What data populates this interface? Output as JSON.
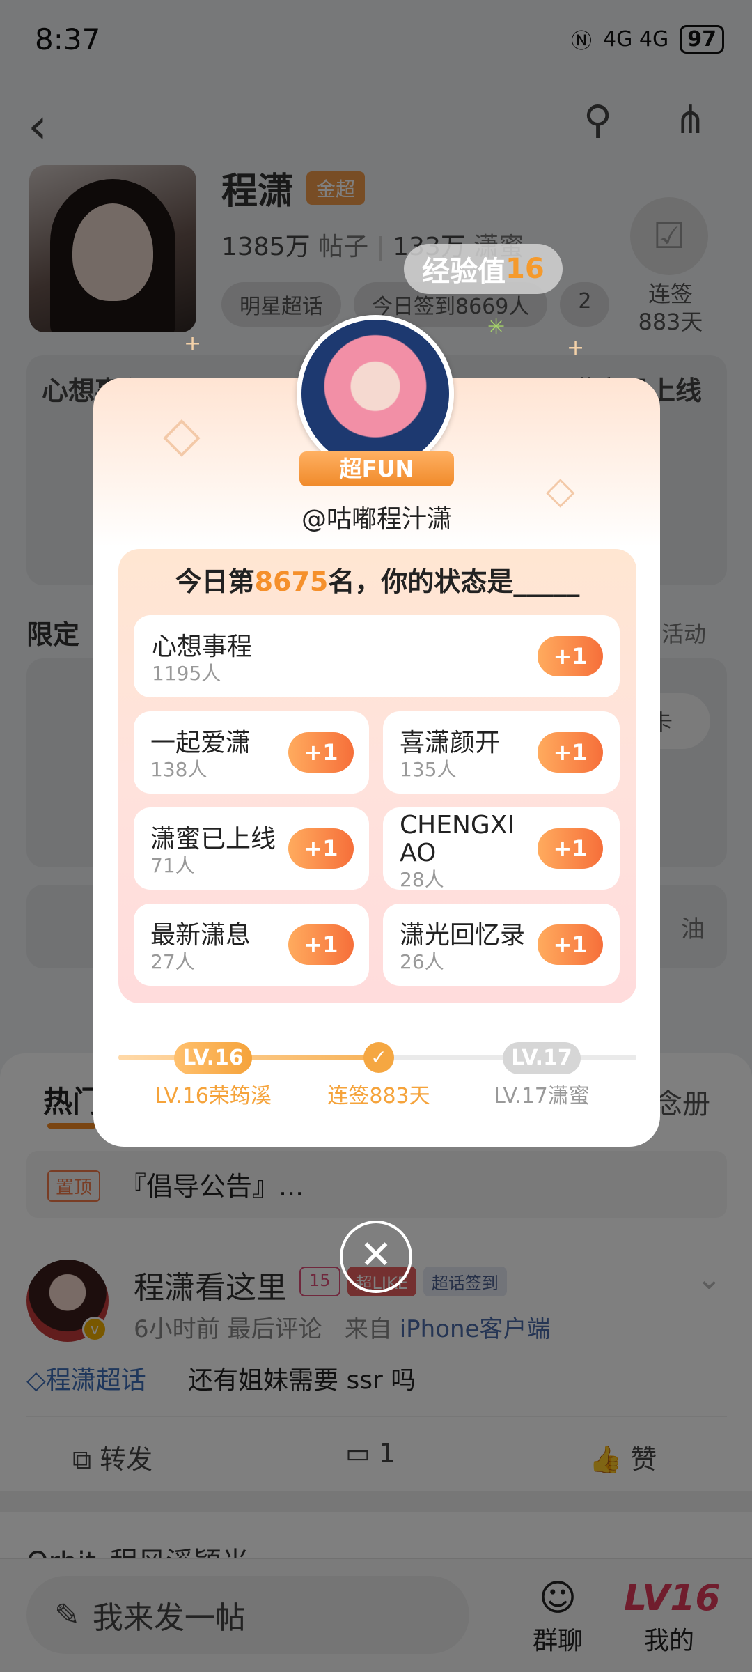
{
  "status_bar": {
    "time": "8:37",
    "signal": "4G 4G",
    "battery": "97"
  },
  "profile": {
    "name": "程潇",
    "badge": "金超",
    "posts": "1385万",
    "posts_label": "帖子",
    "members": "133万",
    "members_label": "潇蜜",
    "tags": [
      "明星超话",
      "今日签到8669人",
      "2"
    ],
    "checkin_label": "连签",
    "checkin_days": "883天"
  },
  "bg_sections": {
    "cards_title_left": "心想事程",
    "cards_title_right": "潇蜜已上线",
    "limited_title": "限定",
    "limited_right": "活动",
    "limited_pill": "卡",
    "post_box_right": "油"
  },
  "feed": {
    "tab_hot": "热门",
    "tab_right": "念册",
    "pinned_badge": "置顶",
    "pinned_text": "『倡导公告』...",
    "post": {
      "name": "程潇看这里",
      "badge_level": "15",
      "badge_like": "超LIKE",
      "badge_sign": "超话签到",
      "time": "6小时前",
      "meta_mid": "最后评论",
      "source": "来自",
      "client": "iPhone客户端",
      "topic": "程潇超话",
      "body": "还有姐妹需要 ssr 吗",
      "repost": "转发",
      "comments": "1",
      "like": "赞"
    },
    "next_post": "Orbit_程风溪颖光"
  },
  "bottom_bar": {
    "compose": "我来发一帖",
    "group_chat": "群聊",
    "mine": "我的",
    "level": "LV16"
  },
  "modal": {
    "exp_label": "经验值",
    "exp_value": "16",
    "ribbon": "超FUN",
    "handle": "@咕嘟程汁潇",
    "today_prefix": "今日第",
    "rank": "8675",
    "today_suffix": "名，你的状态是_____",
    "options": [
      {
        "title": "心想事程",
        "count": "1195人"
      },
      {
        "title": "一起爱潇",
        "count": "138人"
      },
      {
        "title": "喜潇颜开",
        "count": "135人"
      },
      {
        "title": "潇蜜已上线",
        "count": "71人"
      },
      {
        "title": "CHENGXIAO",
        "count": "28人"
      },
      {
        "title": "最新潇息",
        "count": "27人"
      },
      {
        "title": "潇光回忆录",
        "count": "26人"
      }
    ],
    "plus_label": "+1",
    "progress": {
      "current_level": "LV.16",
      "current_label": "LV.16荣筠溪",
      "middle_label": "连签883天",
      "next_level": "LV.17",
      "next_label": "LV.17潇蜜",
      "fraction": 0.5
    }
  },
  "colors": {
    "accent": "#f5902b",
    "plus": "#f66f3a",
    "link": "#3f6fb8"
  }
}
